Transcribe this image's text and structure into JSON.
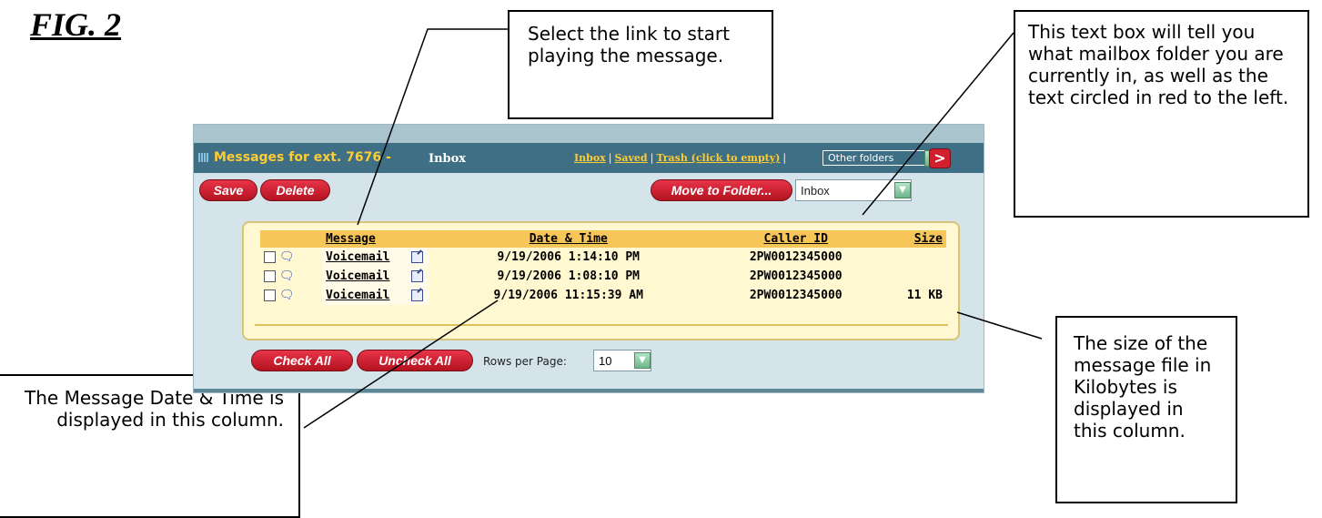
{
  "figure": {
    "title": "FIG. 2"
  },
  "callouts": {
    "top": "Select the link to start playing the message.",
    "right": "This text box will tell you what mailbox folder you are currently in, as well as the text circled in red to the left.",
    "size": "The size of the message file in Kilobytes is displayed in this column.",
    "date": "The Message Date & Time is displayed in this column."
  },
  "app": {
    "title_prefix": "Messages for ext. 7676 -",
    "current_folder": "Inbox",
    "links": {
      "inbox": "Inbox",
      "saved": "Saved",
      "trash": "Trash (click to empty)",
      "sep": "|"
    },
    "other_folders": "Other folders",
    "next_symbol": ">",
    "buttons": {
      "save": "Save",
      "delete": "Delete",
      "move": "Move to Folder...",
      "check_all": "Check All",
      "uncheck_all": "Uncheck All"
    },
    "folder_select": "Inbox",
    "rows_per_page_label": "Rows per Page:",
    "rows_per_page": "10",
    "columns": {
      "message": "Message",
      "datetime": "Date & Time",
      "caller_id": "Caller ID",
      "size": "Size"
    },
    "rows": [
      {
        "message": "Voicemail",
        "datetime": "9/19/2006 1:14:10 PM",
        "caller_id": "2PW0012345000",
        "size": ""
      },
      {
        "message": "Voicemail",
        "datetime": "9/19/2006 1:08:10 PM",
        "caller_id": "2PW0012345000",
        "size": ""
      },
      {
        "message": "Voicemail",
        "datetime": "9/19/2006 11:15:39 AM",
        "caller_id": "2PW0012345000",
        "size": "11 KB"
      }
    ]
  }
}
